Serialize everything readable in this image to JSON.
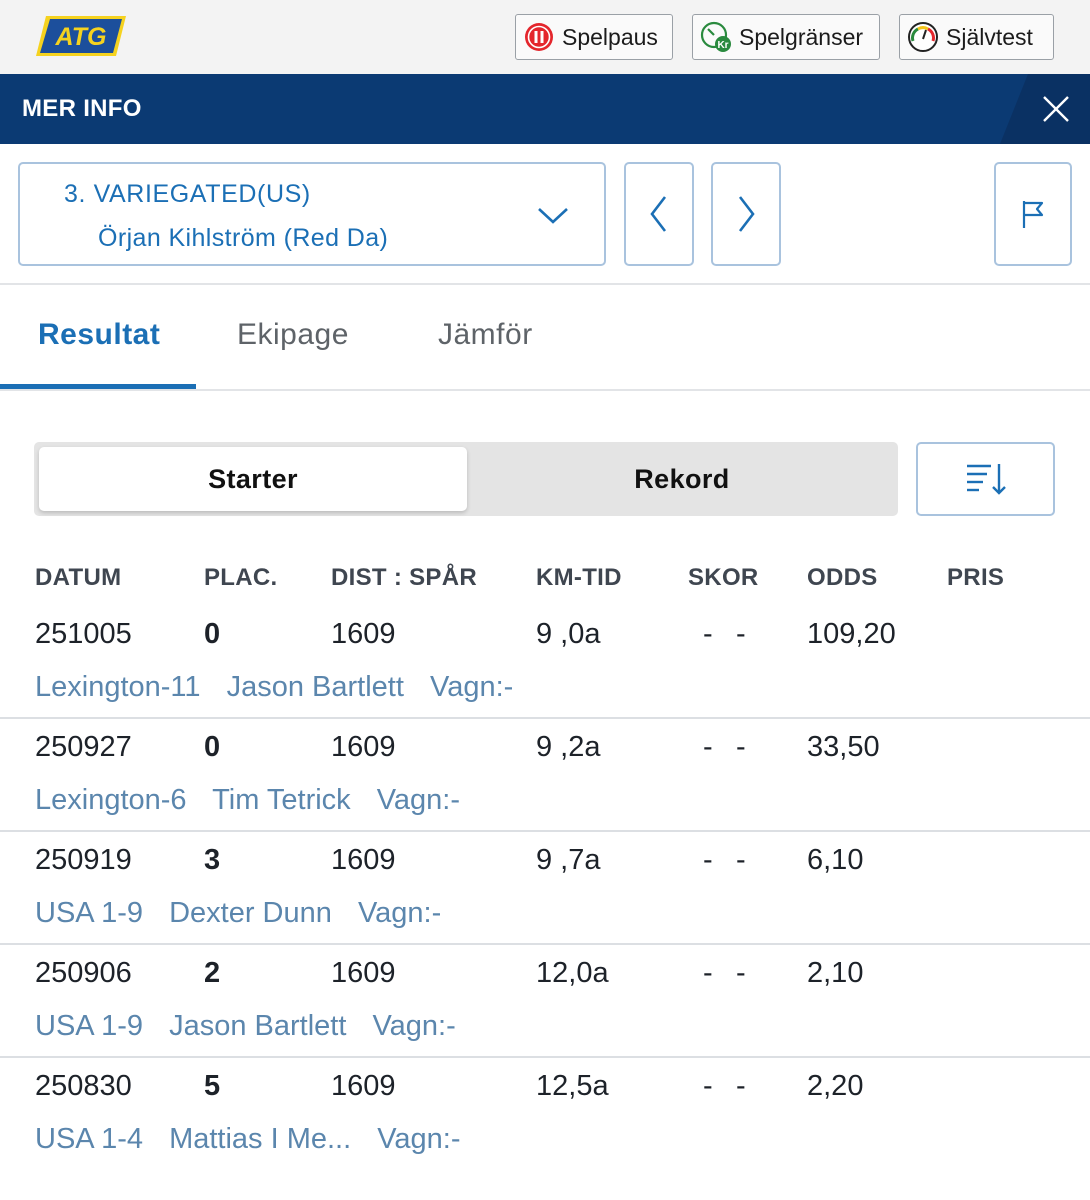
{
  "topbar": {
    "logo_text": "ATG",
    "buttons": [
      {
        "label": "Spelpaus",
        "icon": "pause-icon"
      },
      {
        "label": "Spelgränser",
        "icon": "spending-limit-icon"
      },
      {
        "label": "Självtest",
        "icon": "gauge-icon"
      }
    ]
  },
  "header": {
    "title": "MER INFO"
  },
  "horse": {
    "name": "3. VARIEGATED(US)",
    "driver": "Örjan Kihlström (Red Da)"
  },
  "tabs": [
    {
      "label": "Resultat",
      "active": true
    },
    {
      "label": "Ekipage",
      "active": false
    },
    {
      "label": "Jämför",
      "active": false
    }
  ],
  "segment": {
    "options": [
      "Starter",
      "Rekord"
    ],
    "selected": "Starter"
  },
  "table": {
    "headers": [
      "DATUM",
      "PLAC.",
      "DIST : SPÅR",
      "KM-TID",
      "SKOR",
      "ODDS",
      "PRIS"
    ],
    "rows": [
      {
        "datum": "251005",
        "plac": "0",
        "dist": "1609",
        "kmtid": "9 ,0a",
        "skor1": "-",
        "skor2": "-",
        "odds": "109,20",
        "pris": "",
        "track": "Lexington-11",
        "driver": "Jason Bartlett",
        "vagn": "Vagn:-"
      },
      {
        "datum": "250927",
        "plac": "0",
        "dist": "1609",
        "kmtid": "9 ,2a",
        "skor1": "-",
        "skor2": "-",
        "odds": "33,50",
        "pris": "",
        "track": "Lexington-6",
        "driver": "Tim Tetrick",
        "vagn": "Vagn:-"
      },
      {
        "datum": "250919",
        "plac": "3",
        "dist": "1609",
        "kmtid": "9 ,7a",
        "skor1": "-",
        "skor2": "-",
        "odds": "6,10",
        "pris": "",
        "track": "USA 1-9",
        "driver": "Dexter Dunn",
        "vagn": "Vagn:-"
      },
      {
        "datum": "250906",
        "plac": "2",
        "dist": "1609",
        "kmtid": "12,0a",
        "skor1": "-",
        "skor2": "-",
        "odds": "2,10",
        "pris": "",
        "track": "USA 1-9",
        "driver": "Jason Bartlett",
        "vagn": "Vagn:-"
      },
      {
        "datum": "250830",
        "plac": "5",
        "dist": "1609",
        "kmtid": "12,5a",
        "skor1": "-",
        "skor2": "-",
        "odds": "2,20",
        "pris": "",
        "track": "USA 1-4",
        "driver": "Mattias I Me...",
        "vagn": "Vagn:-"
      }
    ]
  },
  "colors": {
    "brand_blue": "#0b3a73",
    "accent": "#1b6fb5",
    "logo_yellow": "#f5d21f",
    "logo_blue": "#1c4f9c"
  }
}
